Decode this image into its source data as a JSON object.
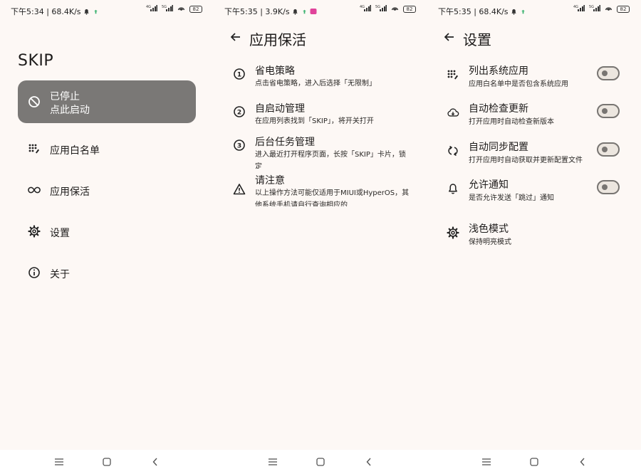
{
  "screen1": {
    "status_bar": {
      "text": "下午5:34 | 68.4K/s",
      "battery": "82"
    },
    "app_title": "SKIP",
    "status_card": {
      "line1": "已停止",
      "line2": "点此启动"
    },
    "menu": [
      {
        "label": "应用白名单",
        "icon": "dots-grid-icon"
      },
      {
        "label": "应用保活",
        "icon": "infinity-icon"
      },
      {
        "label": "设置",
        "icon": "gear-icon"
      },
      {
        "label": "关于",
        "icon": "info-icon"
      }
    ]
  },
  "screen2": {
    "status_bar": {
      "text": "下午5:35 | 3.9K/s",
      "battery": "82"
    },
    "title": "应用保活",
    "steps": [
      {
        "title": "省电策略",
        "desc": "点击省电策略，进入后选择「无限制」",
        "icon": "number-1-icon"
      },
      {
        "title": "自启动管理",
        "desc": "在应用列表找到「SKIP」，将开关打开",
        "icon": "number-2-icon"
      },
      {
        "title": "后台任务管理",
        "desc": "进入最近打开程序页面，长按「SKIP」卡片，锁定",
        "icon": "number-3-icon"
      },
      {
        "title": "请注意",
        "desc": "以上操作方法可能仅适用于MIUI或HyperOS，其他系统手机请自行查询相应的",
        "icon": "warning-icon"
      }
    ]
  },
  "screen3": {
    "status_bar": {
      "text": "下午5:35 | 68.4K/s",
      "battery": "82"
    },
    "title": "设置",
    "settings": [
      {
        "title": "列出系统应用",
        "desc": "应用白名单中是否包含系统应用",
        "icon": "dots-grid-icon",
        "toggle": false
      },
      {
        "title": "自动检查更新",
        "desc": "打开应用时自动检查新版本",
        "icon": "cloud-download-icon",
        "toggle": false
      },
      {
        "title": "自动同步配置",
        "desc": "打开应用时自动获取并更新配置文件",
        "icon": "sync-icon",
        "toggle": false
      },
      {
        "title": "允许通知",
        "desc": "是否允许发送「跳过」通知",
        "icon": "bell-icon",
        "toggle": false
      },
      {
        "title": "浅色模式",
        "desc": "保持明亮模式",
        "icon": "gear-icon"
      }
    ]
  },
  "colors": {
    "background": "#fdf8f5",
    "card": "#7a7876",
    "switch_track": "#ece6df",
    "switch_outline": "#787572"
  }
}
